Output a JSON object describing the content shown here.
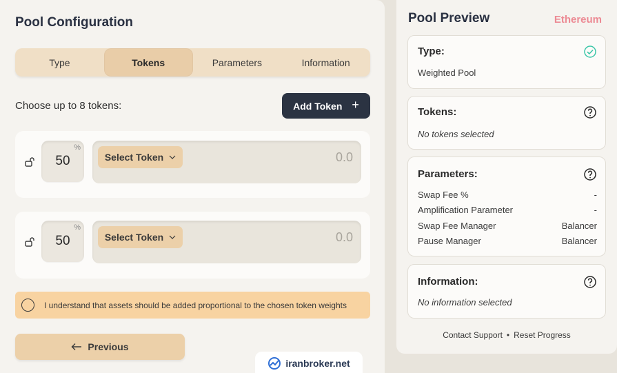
{
  "config": {
    "title": "Pool Configuration",
    "tabs": [
      {
        "label": "Type"
      },
      {
        "label": "Tokens"
      },
      {
        "label": "Parameters"
      },
      {
        "label": "Information"
      }
    ],
    "choose_label": "Choose up to 8 tokens:",
    "add_token_label": "Add Token",
    "tokens": [
      {
        "weight": "50",
        "pct": "%",
        "select_label": "Select Token",
        "amount_placeholder": "0.0"
      },
      {
        "weight": "50",
        "pct": "%",
        "select_label": "Select Token",
        "amount_placeholder": "0.0"
      }
    ],
    "understand_text": "I understand that assets should be added proportional to the chosen token weights",
    "previous_label": "Previous"
  },
  "watermark": "iranbroker.net",
  "preview": {
    "title": "Pool Preview",
    "network": "Ethereum",
    "type": {
      "title": "Type:",
      "value": "Weighted Pool"
    },
    "tokens": {
      "title": "Tokens:",
      "value": "No tokens selected"
    },
    "parameters": {
      "title": "Parameters:",
      "rows": [
        {
          "label": "Swap Fee %",
          "value": "-"
        },
        {
          "label": "Amplification Parameter",
          "value": "-"
        },
        {
          "label": "Swap Fee Manager",
          "value": "Balancer"
        },
        {
          "label": "Pause Manager",
          "value": "Balancer"
        }
      ]
    },
    "information": {
      "title": "Information:",
      "value": "No information selected"
    },
    "footer": {
      "contact": "Contact Support",
      "separator": "•",
      "reset": "Reset Progress"
    }
  },
  "colors": {
    "accent": "#ecd0a9",
    "dark_button": "#2b3342",
    "network": "#ec8a94",
    "success": "#3cc6a8",
    "warning_bg": "#f8d3a1"
  }
}
